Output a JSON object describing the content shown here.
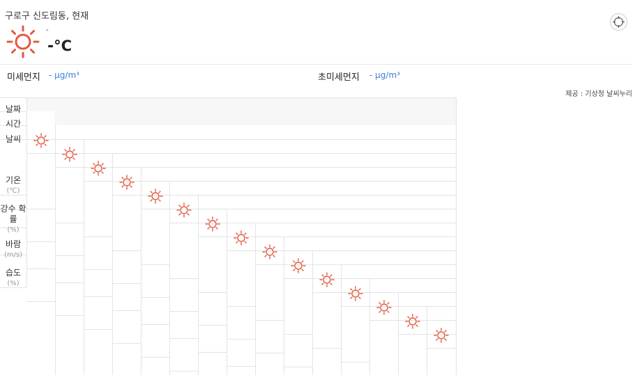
{
  "location": "구로구 신도림동, 현재",
  "current": {
    "icon": "sun-icon",
    "sup": "-",
    "temp_value": "-",
    "temp_unit": "°C"
  },
  "dust": {
    "pm10_label": "미세먼지",
    "pm10_value": "- μg/m³",
    "pm25_label": "초미세먼지",
    "pm25_value": "- μg/m³"
  },
  "provider": "제공 : 기상청 날씨누리",
  "table": {
    "row_labels": [
      {
        "title": "날짜",
        "unit": ""
      },
      {
        "title": "시간",
        "unit": ""
      },
      {
        "title": "날씨",
        "unit": ""
      },
      {
        "title": "기온",
        "unit": "(℃)"
      },
      {
        "title": "강수 확률",
        "unit": "(%)"
      },
      {
        "title": "바람",
        "unit": "(m/s)"
      },
      {
        "title": "습도",
        "unit": "(%)"
      }
    ],
    "columns": 15,
    "column_icon": "sun-icon"
  },
  "colors": {
    "sun": "#e4573d",
    "link": "#3b7ed8",
    "grid": "#e3e3e3"
  }
}
